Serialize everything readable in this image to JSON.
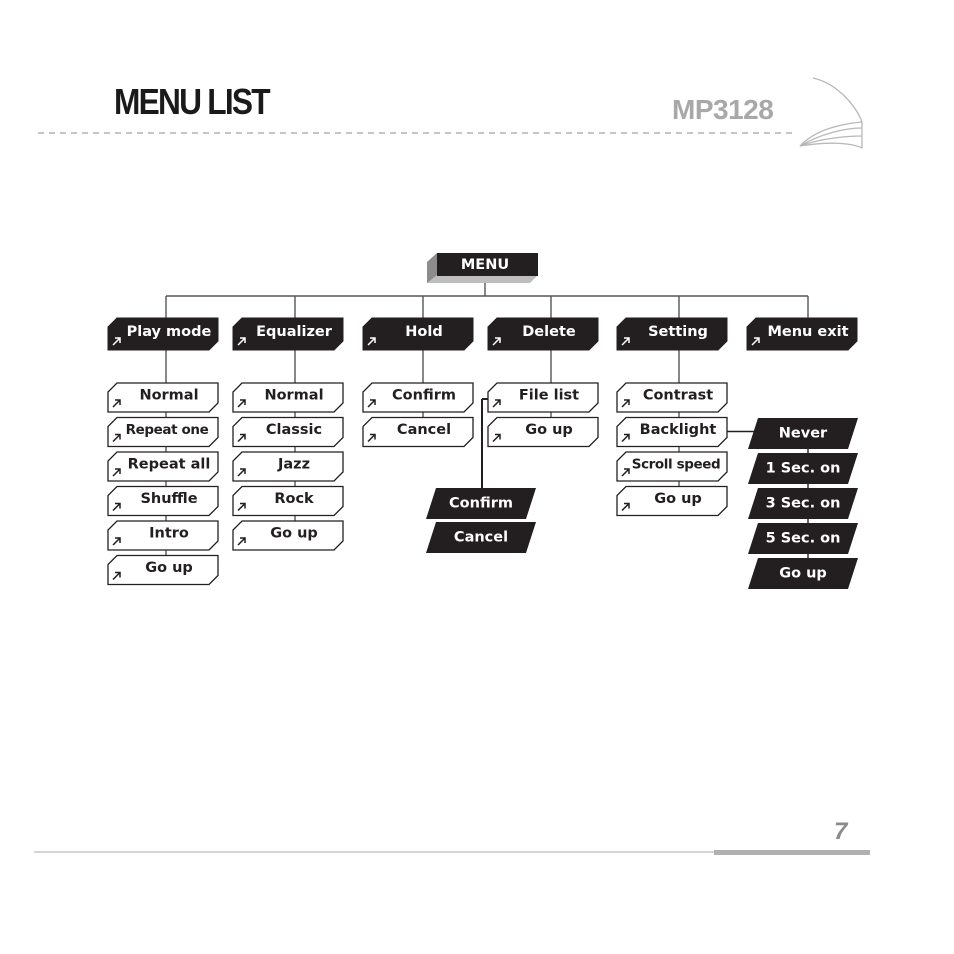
{
  "header": {
    "title": "MENU LIST",
    "model": "MP3128"
  },
  "footer": {
    "page_number": "7"
  },
  "menu": {
    "root": "MENU",
    "categories": [
      {
        "label": "Play mode",
        "items": [
          "Normal",
          "Repeat one",
          "Repeat all",
          "Shuffle",
          "Intro",
          "Go up"
        ]
      },
      {
        "label": "Equalizer",
        "items": [
          "Normal",
          "Classic",
          "Jazz",
          "Rock",
          "Go up"
        ]
      },
      {
        "label": "Hold",
        "items": [
          "Confirm",
          "Cancel"
        ]
      },
      {
        "label": "Delete",
        "items": [
          "File list",
          "Go up"
        ],
        "file_list_submenu": [
          "Confirm",
          "Cancel"
        ]
      },
      {
        "label": "Setting",
        "items": [
          "Contrast",
          "Backlight",
          "Scroll speed",
          "Go up"
        ],
        "backlight_submenu": [
          "Never",
          "1 Sec. on",
          "3 Sec. on",
          "5 Sec. on",
          "Go up"
        ]
      },
      {
        "label": "Menu exit",
        "items": []
      }
    ]
  },
  "icons": {
    "item_marker": "arrow-up-right-icon"
  },
  "colors": {
    "box_dark": "#231f20",
    "text_light": "#ffffff",
    "outline": "#231f20",
    "line": "#555555",
    "header_gray": "#a8a8a8",
    "rule_gray": "#b4b4b4"
  }
}
